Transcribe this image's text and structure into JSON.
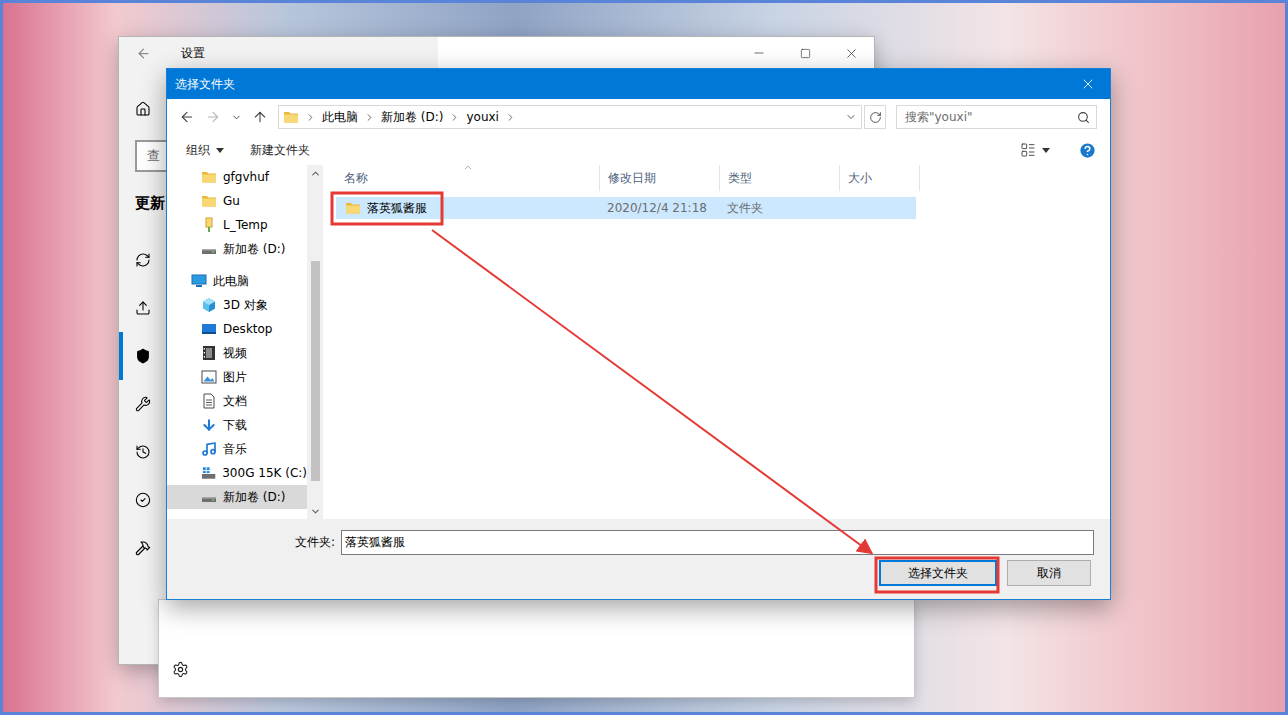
{
  "settings_window": {
    "title": "设置",
    "search": {
      "placeholder": "查"
    },
    "section": "更新",
    "sidebar_items": [
      {
        "kind": "home",
        "selected": false
      },
      {
        "kind": "sync",
        "selected": false
      },
      {
        "kind": "delivery",
        "selected": false
      },
      {
        "kind": "shield",
        "selected": true
      },
      {
        "kind": "wrench",
        "selected": false
      },
      {
        "kind": "history",
        "selected": false
      },
      {
        "kind": "check",
        "selected": false
      },
      {
        "kind": "tools",
        "selected": false
      }
    ]
  },
  "dialog": {
    "title": "选择文件夹",
    "breadcrumb": [
      "此电脑",
      "新加卷 (D:)",
      "youxi"
    ],
    "search": {
      "placeholder": "搜索\"youxi\""
    },
    "toolbar": [
      {
        "label": "组织",
        "dropdown": true
      },
      {
        "label": "新建文件夹",
        "dropdown": false
      }
    ],
    "tree": [
      {
        "label": "gfgvhuf",
        "kind": "folder",
        "selected": false
      },
      {
        "label": "Gu",
        "kind": "folder",
        "selected": false
      },
      {
        "label": "L_Temp",
        "kind": "folder-special",
        "selected": false
      },
      {
        "label": "新加卷 (D:)",
        "kind": "drive",
        "selected": false
      },
      {
        "label": "此电脑",
        "kind": "pc",
        "selected": false
      },
      {
        "label": "3D 对象",
        "kind": "cube",
        "selected": false
      },
      {
        "label": "Desktop",
        "kind": "desktop",
        "selected": false
      },
      {
        "label": "视频",
        "kind": "video",
        "selected": false
      },
      {
        "label": "图片",
        "kind": "picture",
        "selected": false
      },
      {
        "label": "文档",
        "kind": "doc",
        "selected": false
      },
      {
        "label": "下载",
        "kind": "download",
        "selected": false
      },
      {
        "label": "音乐",
        "kind": "music",
        "selected": false
      },
      {
        "label": "300G 15K (C:)",
        "kind": "drive-c",
        "selected": false
      },
      {
        "label": "新加卷 (D:)",
        "kind": "drive",
        "selected": true
      }
    ],
    "columns": [
      {
        "label": "名称",
        "sorted": true
      },
      {
        "label": "修改日期",
        "sorted": false
      },
      {
        "label": "类型",
        "sorted": false
      },
      {
        "label": "大小",
        "sorted": false
      }
    ],
    "rows": [
      {
        "name": "落英狐酱服",
        "modified": "2020/12/4 21:18",
        "type": "文件夹",
        "size": "",
        "selected": true
      }
    ],
    "folder_field": {
      "label": "文件夹:",
      "value": "落英狐酱服"
    },
    "buttons": [
      {
        "label": "选择文件夹",
        "default": true
      },
      {
        "label": "取消",
        "default": false
      }
    ]
  },
  "annotations": [
    {
      "kind": "box",
      "target": "folder-row"
    },
    {
      "kind": "box",
      "target": "select-button"
    },
    {
      "kind": "arrow",
      "target": "select-button"
    }
  ]
}
